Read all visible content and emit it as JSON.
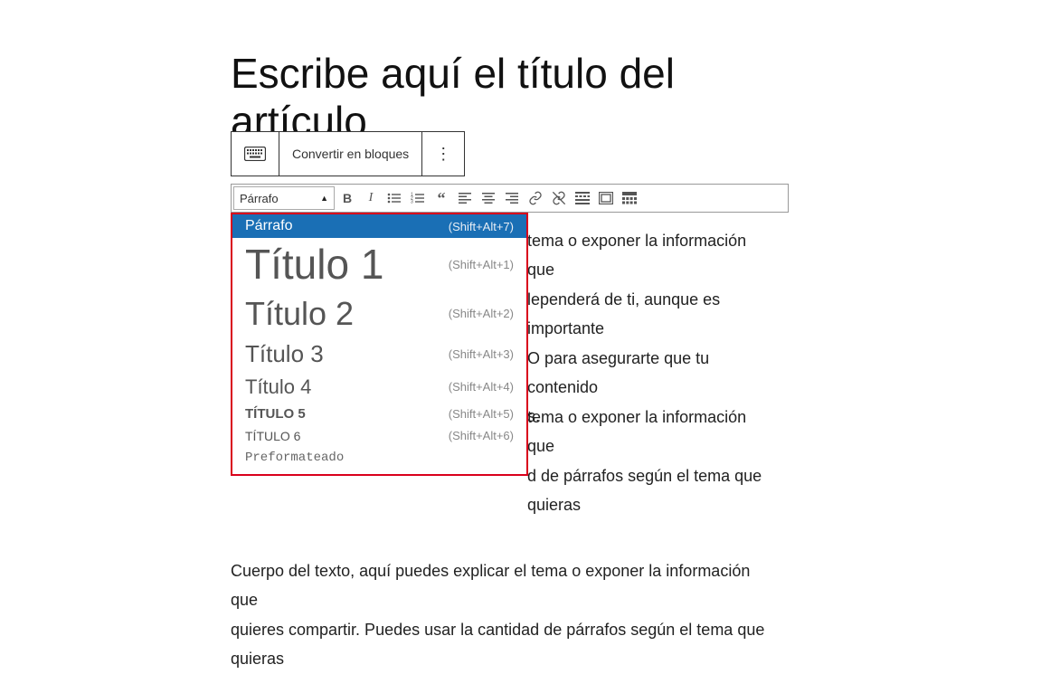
{
  "title": "Escribe aquí el título del artículo",
  "toolbar_block": {
    "convert_label": "Convertir en bloques"
  },
  "format_bar": {
    "select_value": "Párrafo"
  },
  "dropdown": {
    "items": [
      {
        "label": "Párrafo",
        "shortcut": "(Shift+Alt+7)",
        "cls": "dd-parrafo",
        "selected": true
      },
      {
        "label": "Título 1",
        "shortcut": "(Shift+Alt+1)",
        "cls": "dd-t1",
        "selected": false
      },
      {
        "label": "Título 2",
        "shortcut": "(Shift+Alt+2)",
        "cls": "dd-t2",
        "selected": false
      },
      {
        "label": "Título 3",
        "shortcut": "(Shift+Alt+3)",
        "cls": "dd-t3",
        "selected": false
      },
      {
        "label": "Título 4",
        "shortcut": "(Shift+Alt+4)",
        "cls": "dd-t4",
        "selected": false
      },
      {
        "label": "TÍTULO 5",
        "shortcut": "(Shift+Alt+5)",
        "cls": "dd-t5",
        "selected": false
      },
      {
        "label": "TÍTULO 6",
        "shortcut": "(Shift+Alt+6)",
        "cls": "dd-t6",
        "selected": false
      },
      {
        "label": "Preformateado",
        "shortcut": "",
        "cls": "dd-pre",
        "selected": false
      }
    ]
  },
  "body": {
    "p1": "tema o exponer la información que",
    "p2": "lependerá de ti, aunque es importante",
    "p3": "O para asegurarte que tu contenido",
    "p4": "s.",
    "p5": "tema o exponer la información que",
    "p6": "d de párrafos según el tema que quieras",
    "p7": "Cuerpo del texto, aquí puedes explicar el tema o exponer la información que",
    "p8": "quieres compartir. Puedes usar la cantidad de párrafos según el tema que quieras"
  }
}
